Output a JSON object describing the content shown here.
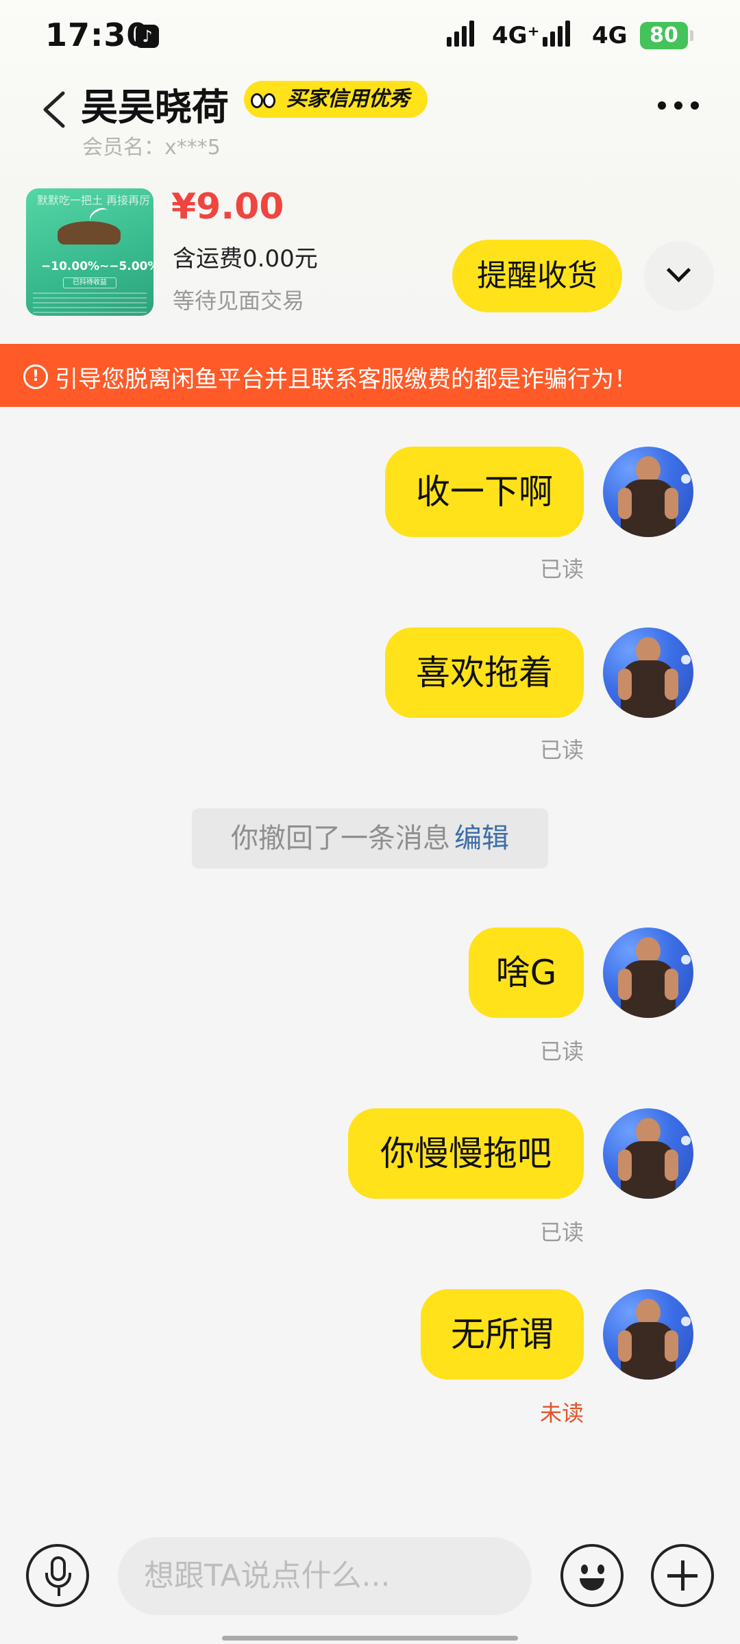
{
  "status_bar": {
    "time": "17:30",
    "tiktok_icon": "tiktok-icon",
    "net1": "4G⁺",
    "net2": "4G",
    "battery": "80"
  },
  "header": {
    "title": "吴吴晓荷",
    "credit_badge": "买家信用优秀",
    "member_label": "会员名：x***5"
  },
  "product": {
    "thumb_text_top": "默默吃一把土 再接再厉",
    "thumb_text_rate": "−10.00%~−5.00%",
    "thumb_text_btn": "已抖待收益",
    "price": "¥9.00",
    "shipping": "含运费0.00元",
    "status": "等待见面交易",
    "remind_button": "提醒收货"
  },
  "warning": {
    "text": "引导您脱离闲鱼平台并且联系客服缴费的都是诈骗行为！"
  },
  "messages": [
    {
      "text": "收一下啊",
      "status": "已读"
    },
    {
      "text": "喜欢拖着",
      "status": "已读"
    },
    {
      "text": "啥G",
      "status": "已读"
    },
    {
      "text": "你慢慢拖吧",
      "status": "已读"
    },
    {
      "text": "无所谓",
      "status": "未读"
    }
  ],
  "recall": {
    "text": "你撤回了一条消息",
    "edit": "编辑"
  },
  "input": {
    "placeholder": "想跟TA说点什么..."
  },
  "colors": {
    "accent": "#ffe21a",
    "warning": "#ff5a27",
    "price": "#f0453f",
    "unread": "#e1532b",
    "edit": "#3d6ea8"
  }
}
